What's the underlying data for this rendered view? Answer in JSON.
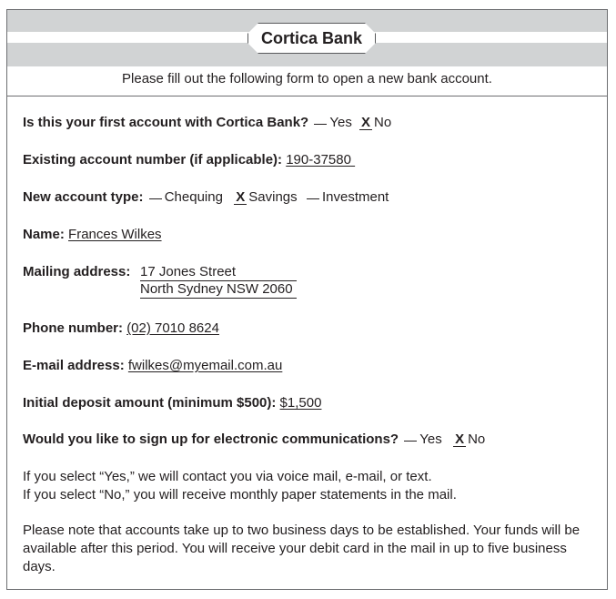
{
  "header": {
    "bank_name": "Cortica Bank",
    "intro": "Please fill out the following form to open a new bank account."
  },
  "form": {
    "first_account": {
      "label": "Is this your first account with Cortica Bank?",
      "yes": "Yes",
      "no": "No",
      "mark": "X"
    },
    "existing_account": {
      "label": "Existing account number (if applicable):",
      "value": "190-37580"
    },
    "account_type": {
      "label": "New account type:",
      "chequing": "Chequing",
      "savings": "Savings",
      "investment": "Investment",
      "mark": "X"
    },
    "name": {
      "label": "Name:",
      "value": "Frances Wilkes"
    },
    "mailing_address": {
      "label": "Mailing address:",
      "line1": "17 Jones Street",
      "line2": "North Sydney NSW 2060"
    },
    "phone": {
      "label": "Phone number:",
      "value": "(02) 7010 8624"
    },
    "email": {
      "label": "E-mail address:",
      "value": "fwilkes@myemail.com.au"
    },
    "deposit": {
      "label": "Initial deposit amount (minimum $500):",
      "value": "$1,500"
    },
    "electronic": {
      "label": "Would you like to sign up for electronic communications?",
      "yes": "Yes",
      "no": "No",
      "mark": "X"
    }
  },
  "notes": {
    "yes_note": "If you select “Yes,” we will contact you via voice mail, e-mail, or text.",
    "no_note": "If you select “No,” you will receive monthly paper statements in the mail.",
    "processing": "Please note that accounts take up to two business days to be established. Your funds will be available after this period. You will receive your debit card in the mail in up to five business days."
  }
}
